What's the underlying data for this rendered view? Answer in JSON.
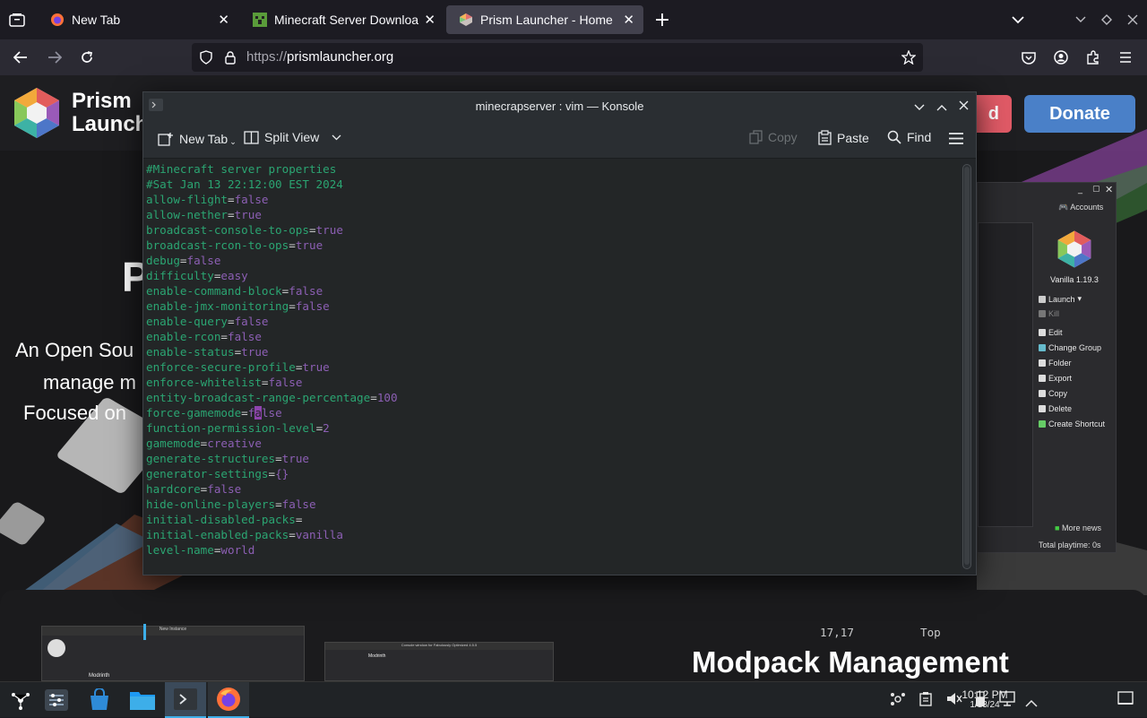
{
  "browser": {
    "tabs": [
      {
        "label": "New Tab",
        "icon": "firefox-icon"
      },
      {
        "label": "Minecraft Server Downloa",
        "icon": "minecraft-icon"
      },
      {
        "label": "Prism Launcher - Home",
        "icon": "prism-icon"
      }
    ],
    "url_scheme": "https://",
    "url_host": "prismlauncher.org"
  },
  "site": {
    "logo_line1": "Prism",
    "logo_line2": "Launche",
    "download_label": "d",
    "donate_label": "Donate",
    "hero_big": "P",
    "hero_line1": "An Open Sou",
    "hero_line2": "manage m",
    "hero_line3": "Focused on",
    "section_heading": "Modpack Management"
  },
  "prism_window": {
    "accounts": "Accounts",
    "instance": "Vanilla 1.19.3",
    "actions": [
      "Launch",
      "Kill",
      "Edit",
      "Change Group",
      "Folder",
      "Export",
      "Copy",
      "Delete",
      "Create Shortcut"
    ],
    "more_news": "More news",
    "playtime": "Total playtime: 0s"
  },
  "konsole": {
    "title": "minecrapserver : vim — Konsole",
    "toolbar": {
      "new_tab": "New Tab",
      "split_view": "Split View",
      "copy": "Copy",
      "paste": "Paste",
      "find": "Find"
    },
    "comments": [
      "#Minecraft server properties",
      "#Sat Jan 13 22:12:00 EST 2024"
    ],
    "props": [
      {
        "k": "allow-flight",
        "v": "false"
      },
      {
        "k": "allow-nether",
        "v": "true"
      },
      {
        "k": "broadcast-console-to-ops",
        "v": "true"
      },
      {
        "k": "broadcast-rcon-to-ops",
        "v": "true"
      },
      {
        "k": "debug",
        "v": "false"
      },
      {
        "k": "difficulty",
        "v": "easy"
      },
      {
        "k": "enable-command-block",
        "v": "false"
      },
      {
        "k": "enable-jmx-monitoring",
        "v": "false"
      },
      {
        "k": "enable-query",
        "v": "false"
      },
      {
        "k": "enable-rcon",
        "v": "false"
      },
      {
        "k": "enable-status",
        "v": "true"
      },
      {
        "k": "enforce-secure-profile",
        "v": "true"
      },
      {
        "k": "enforce-whitelist",
        "v": "false"
      },
      {
        "k": "entity-broadcast-range-percentage",
        "v": "100"
      },
      {
        "k": "force-gamemode",
        "v": "false"
      },
      {
        "k": "function-permission-level",
        "v": "2"
      },
      {
        "k": "gamemode",
        "v": "creative"
      },
      {
        "k": "generate-structures",
        "v": "true"
      },
      {
        "k": "generator-settings",
        "v": "{}"
      },
      {
        "k": "hardcore",
        "v": "false"
      },
      {
        "k": "hide-online-players",
        "v": "false"
      },
      {
        "k": "initial-disabled-packs",
        "v": ""
      },
      {
        "k": "initial-enabled-packs",
        "v": "vanilla"
      },
      {
        "k": "level-name",
        "v": "world"
      }
    ],
    "cursor_line": 14,
    "cursor_col": 1,
    "position": "17,17",
    "scroll_pos": "Top"
  },
  "taskbar": {
    "time": "10:12 PM",
    "date": "1/13/24"
  },
  "thumbnails": {
    "left_title": "New Instance",
    "left_heading": "Modrinth",
    "right_title": "Console window for Fabulously Optimized 4.5.5",
    "right_heading": "Modrinth"
  }
}
